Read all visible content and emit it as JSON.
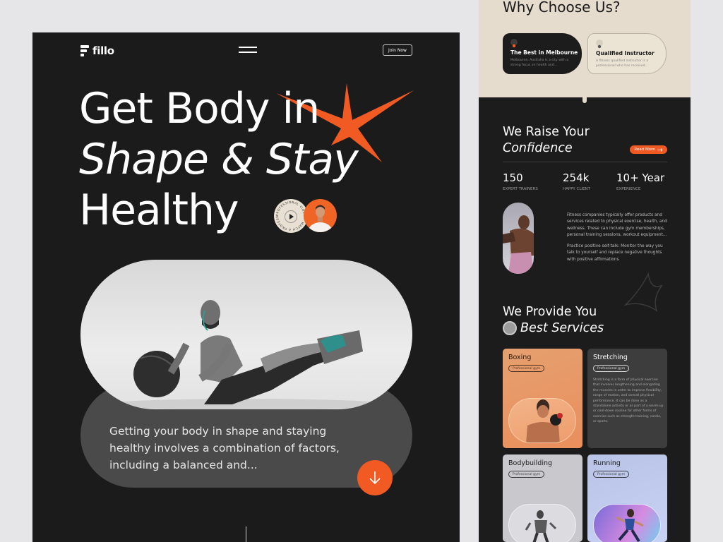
{
  "brand": {
    "name": "fillo"
  },
  "header": {
    "join_label": "Join Now"
  },
  "hero": {
    "line1": "Get Body in",
    "line2": "Shape & Stay",
    "line3": "Healthy"
  },
  "video_badge": {
    "text": "PROFESSIONAL VIDEO • WATCH A PROFESSIONAL •"
  },
  "intro": {
    "text": "Getting your body in shape and staying healthy involves a combination of factors, including a balanced and..."
  },
  "why": {
    "title": "Why Choose Us?",
    "cards": [
      {
        "title": "The Best in Melbourne",
        "desc": "Melbourne, Australia is a city with a strong focus on health and..."
      },
      {
        "title": "Qualified Instructor",
        "desc": "A fitness qualified instructor is a professional who has received..."
      }
    ]
  },
  "confidence": {
    "title_line1": "We Raise Your",
    "title_line2": "Confidence",
    "read_more": "Read More",
    "stats": [
      {
        "value": "150",
        "label": "EXPERT TRAINERS"
      },
      {
        "value": "254k",
        "label": "HAPPY CLIENT"
      },
      {
        "value": "10+ Year",
        "label": "EXPERIENCE"
      }
    ],
    "para1": "Fitness companies typically offer products and services related to physical exercise, health, and wellness. These can include gym memberships, personal training sessions, workout equipment...",
    "para2": "Practice positive self-talk: Monitor the way you talk to yourself and replace negative thoughts with positive affirmations"
  },
  "services": {
    "title_line1": "We Provide You",
    "title_line2": "Best Services",
    "cards": [
      {
        "title": "Boxing",
        "tag": "Professional gym",
        "bg": "#e89b6a"
      },
      {
        "title": "Stretching",
        "tag": "Professional gym",
        "bg": "#3b3b3b",
        "desc": "Stretching is a form of physical exercise that involves lengthening and elongating the muscles in order to improve flexibility, range of motion, and overall physical performance. It can be done as a standalone activity or as part of a warm-up or cool-down routine for other forms of exercise such as strength training, cardio, or sports."
      },
      {
        "title": "Bodybuilding",
        "tag": "Professional gym",
        "bg": "#c9c8cc"
      },
      {
        "title": "Running",
        "tag": "Professional gym",
        "bg": "#b8c6ec"
      }
    ]
  },
  "colors": {
    "accent": "#f15a22",
    "dark": "#1b1b1b",
    "cream": "#e5dccd"
  }
}
